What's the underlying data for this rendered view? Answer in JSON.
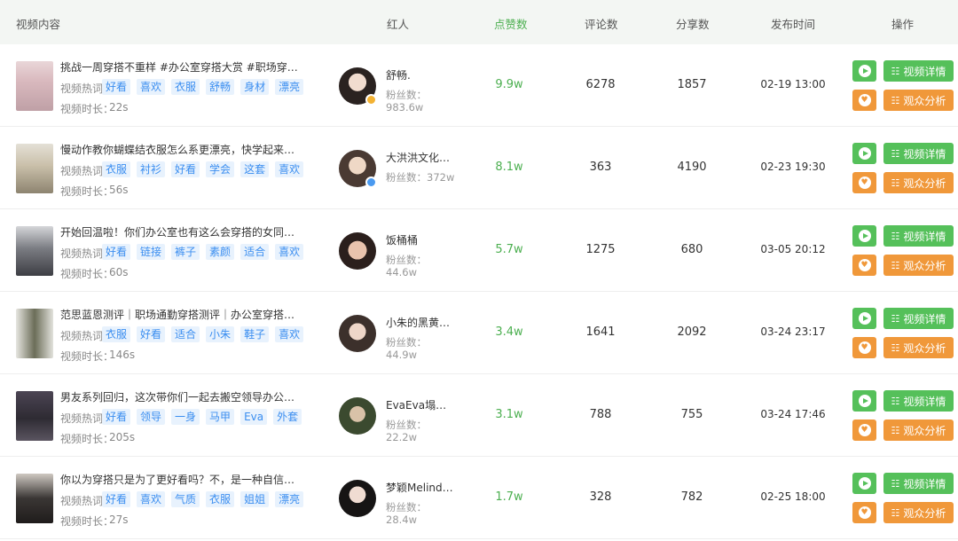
{
  "header": {
    "video": "视频内容",
    "influencer": "红人",
    "likes": "点赞数",
    "comments": "评论数",
    "shares": "分享数",
    "time": "发布时间",
    "ops": "操作"
  },
  "labels": {
    "hot": "视频热词",
    "duration": "视频时长：",
    "fans": "粉丝数：",
    "detail": "视频详情",
    "analysis": "观众分析"
  },
  "colors": {
    "green": "#55c05a",
    "orange": "#f0983a",
    "tag_bg": "#e8f2fd",
    "tag_text": "#3b8ef0"
  },
  "rows": [
    {
      "title": "挑战一周穿搭不重样 #办公室穿搭大赏 #职场穿搭 #…",
      "tags": [
        "好看",
        "喜欢",
        "衣服",
        "舒畅",
        "身材",
        "漂亮"
      ],
      "duration": "22s",
      "influencer": "舒畅.",
      "fans": "983.6w",
      "likes": "9.9w",
      "comments": "6278",
      "shares": "1857",
      "time": "02-19 13:00",
      "badge": "gold"
    },
    {
      "title": "慢动作教你蝴蝶结衣服怎么系更漂亮，快学起来吧~#…",
      "tags": [
        "衣服",
        "衬衫",
        "好看",
        "学会",
        "这套",
        "喜欢"
      ],
      "duration": "56s",
      "influencer": "大洪洪文化…",
      "fans": "372w",
      "likes": "8.1w",
      "comments": "363",
      "shares": "4190",
      "time": "02-23 19:30",
      "badge": "blue"
    },
    {
      "title": "开始回温啦！你们办公室也有这么会穿搭的女同事嘛…",
      "tags": [
        "好看",
        "链接",
        "裤子",
        "素颜",
        "适合",
        "喜欢"
      ],
      "duration": "60s",
      "influencer": "饭桶桶",
      "fans": "44.6w",
      "likes": "5.7w",
      "comments": "1275",
      "shares": "680",
      "time": "03-05 20:12",
      "badge": ""
    },
    {
      "title": "范思蓝恩测评｜职场通勤穿搭测评｜办公室穿搭｜#显…",
      "tags": [
        "衣服",
        "好看",
        "适合",
        "小朱",
        "鞋子",
        "喜欢"
      ],
      "duration": "146s",
      "influencer": "小朱的黑黄…",
      "fans": "44.9w",
      "likes": "3.4w",
      "comments": "1641",
      "shares": "2092",
      "time": "03-24 23:17",
      "badge": ""
    },
    {
      "title": "男友系列回归，这次带你们一起去搬空领导办公室！…",
      "tags": [
        "好看",
        "领导",
        "一身",
        "马甲",
        "Eva",
        "外套"
      ],
      "duration": "205s",
      "influencer": "EvaEva塌鼻…",
      "fans": "22.2w",
      "likes": "3.1w",
      "comments": "788",
      "shares": "755",
      "time": "03-24 17:46",
      "badge": ""
    },
    {
      "title": "你以为穿搭只是为了更好看吗？不，是一种自信时髦…",
      "tags": [
        "好看",
        "喜欢",
        "气质",
        "衣服",
        "姐姐",
        "漂亮"
      ],
      "duration": "27s",
      "influencer": "梦颖Melinda…",
      "fans": "28.4w",
      "likes": "1.7w",
      "comments": "328",
      "shares": "782",
      "time": "02-25 18:00",
      "badge": ""
    }
  ]
}
